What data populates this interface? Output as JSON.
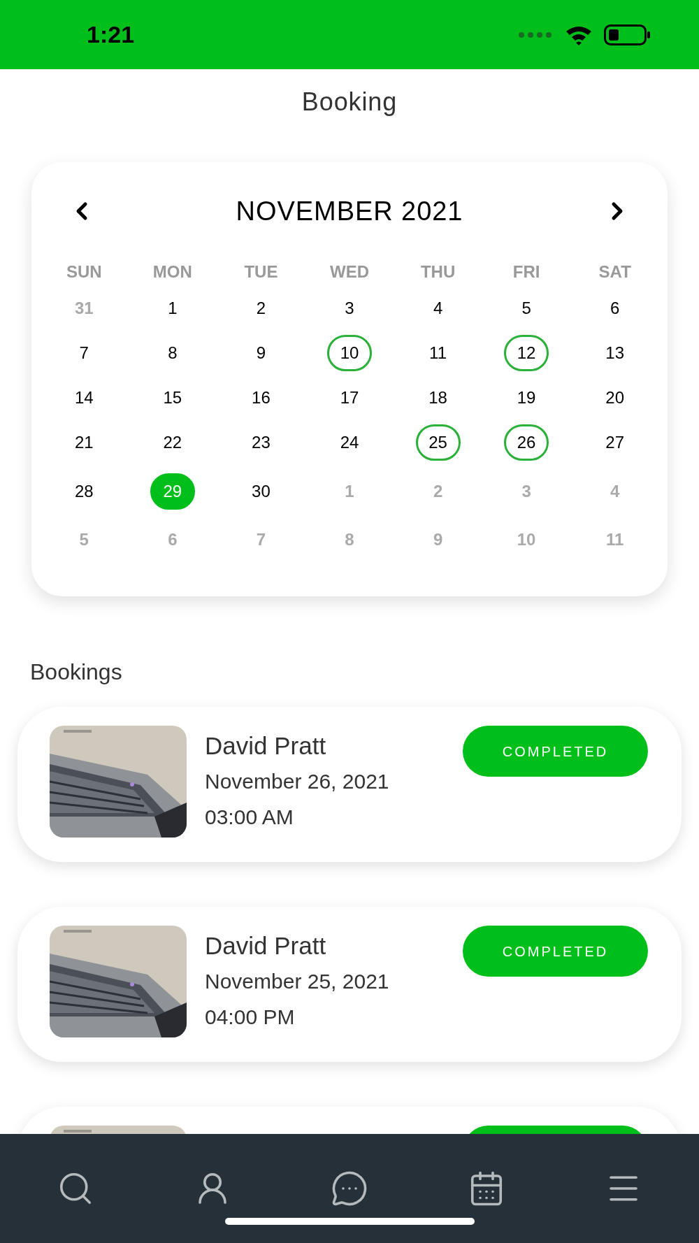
{
  "status_bar": {
    "time": "1:21"
  },
  "header": {
    "title": "Booking"
  },
  "calendar": {
    "month": "NOVEMBER 2021",
    "weekdays": [
      "SUN",
      "MON",
      "TUE",
      "WED",
      "THU",
      "FRI",
      "SAT"
    ],
    "days": [
      {
        "day": "31",
        "in_month": false,
        "selected": false,
        "booked": false
      },
      {
        "day": "1",
        "in_month": true,
        "selected": false,
        "booked": false
      },
      {
        "day": "2",
        "in_month": true,
        "selected": false,
        "booked": false
      },
      {
        "day": "3",
        "in_month": true,
        "selected": false,
        "booked": false
      },
      {
        "day": "4",
        "in_month": true,
        "selected": false,
        "booked": false
      },
      {
        "day": "5",
        "in_month": true,
        "selected": false,
        "booked": false
      },
      {
        "day": "6",
        "in_month": true,
        "selected": false,
        "booked": false
      },
      {
        "day": "7",
        "in_month": true,
        "selected": false,
        "booked": false
      },
      {
        "day": "8",
        "in_month": true,
        "selected": false,
        "booked": false
      },
      {
        "day": "9",
        "in_month": true,
        "selected": false,
        "booked": false
      },
      {
        "day": "10",
        "in_month": true,
        "selected": false,
        "booked": true
      },
      {
        "day": "11",
        "in_month": true,
        "selected": false,
        "booked": false
      },
      {
        "day": "12",
        "in_month": true,
        "selected": false,
        "booked": true
      },
      {
        "day": "13",
        "in_month": true,
        "selected": false,
        "booked": false
      },
      {
        "day": "14",
        "in_month": true,
        "selected": false,
        "booked": false
      },
      {
        "day": "15",
        "in_month": true,
        "selected": false,
        "booked": false
      },
      {
        "day": "16",
        "in_month": true,
        "selected": false,
        "booked": false
      },
      {
        "day": "17",
        "in_month": true,
        "selected": false,
        "booked": false
      },
      {
        "day": "18",
        "in_month": true,
        "selected": false,
        "booked": false
      },
      {
        "day": "19",
        "in_month": true,
        "selected": false,
        "booked": false
      },
      {
        "day": "20",
        "in_month": true,
        "selected": false,
        "booked": false
      },
      {
        "day": "21",
        "in_month": true,
        "selected": false,
        "booked": false
      },
      {
        "day": "22",
        "in_month": true,
        "selected": false,
        "booked": false
      },
      {
        "day": "23",
        "in_month": true,
        "selected": false,
        "booked": false
      },
      {
        "day": "24",
        "in_month": true,
        "selected": false,
        "booked": false
      },
      {
        "day": "25",
        "in_month": true,
        "selected": false,
        "booked": true
      },
      {
        "day": "26",
        "in_month": true,
        "selected": false,
        "booked": true
      },
      {
        "day": "27",
        "in_month": true,
        "selected": false,
        "booked": false
      },
      {
        "day": "28",
        "in_month": true,
        "selected": false,
        "booked": false
      },
      {
        "day": "29",
        "in_month": true,
        "selected": true,
        "booked": false
      },
      {
        "day": "30",
        "in_month": true,
        "selected": false,
        "booked": false
      },
      {
        "day": "1",
        "in_month": false,
        "selected": false,
        "booked": false
      },
      {
        "day": "2",
        "in_month": false,
        "selected": false,
        "booked": false
      },
      {
        "day": "3",
        "in_month": false,
        "selected": false,
        "booked": false
      },
      {
        "day": "4",
        "in_month": false,
        "selected": false,
        "booked": false
      },
      {
        "day": "5",
        "in_month": false,
        "selected": false,
        "booked": false
      },
      {
        "day": "6",
        "in_month": false,
        "selected": false,
        "booked": false
      },
      {
        "day": "7",
        "in_month": false,
        "selected": false,
        "booked": false
      },
      {
        "day": "8",
        "in_month": false,
        "selected": false,
        "booked": false
      },
      {
        "day": "9",
        "in_month": false,
        "selected": false,
        "booked": false
      },
      {
        "day": "10",
        "in_month": false,
        "selected": false,
        "booked": false
      },
      {
        "day": "11",
        "in_month": false,
        "selected": false,
        "booked": false
      }
    ]
  },
  "bookings_title": "Bookings",
  "bookings": [
    {
      "kind": "full",
      "name": "David Pratt",
      "date": "November 26, 2021",
      "time": "03:00 AM",
      "status": "COMPLETED"
    },
    {
      "kind": "full",
      "name": "David Pratt",
      "date": "November 25, 2021",
      "time": "04:00 PM",
      "status": "COMPLETED"
    },
    {
      "kind": "cut"
    }
  ],
  "nav_bar": {
    "items": [
      {
        "kind": "search"
      },
      {
        "kind": "user"
      },
      {
        "kind": "chat"
      },
      {
        "kind": "calendar"
      },
      {
        "kind": "menu"
      }
    ]
  }
}
